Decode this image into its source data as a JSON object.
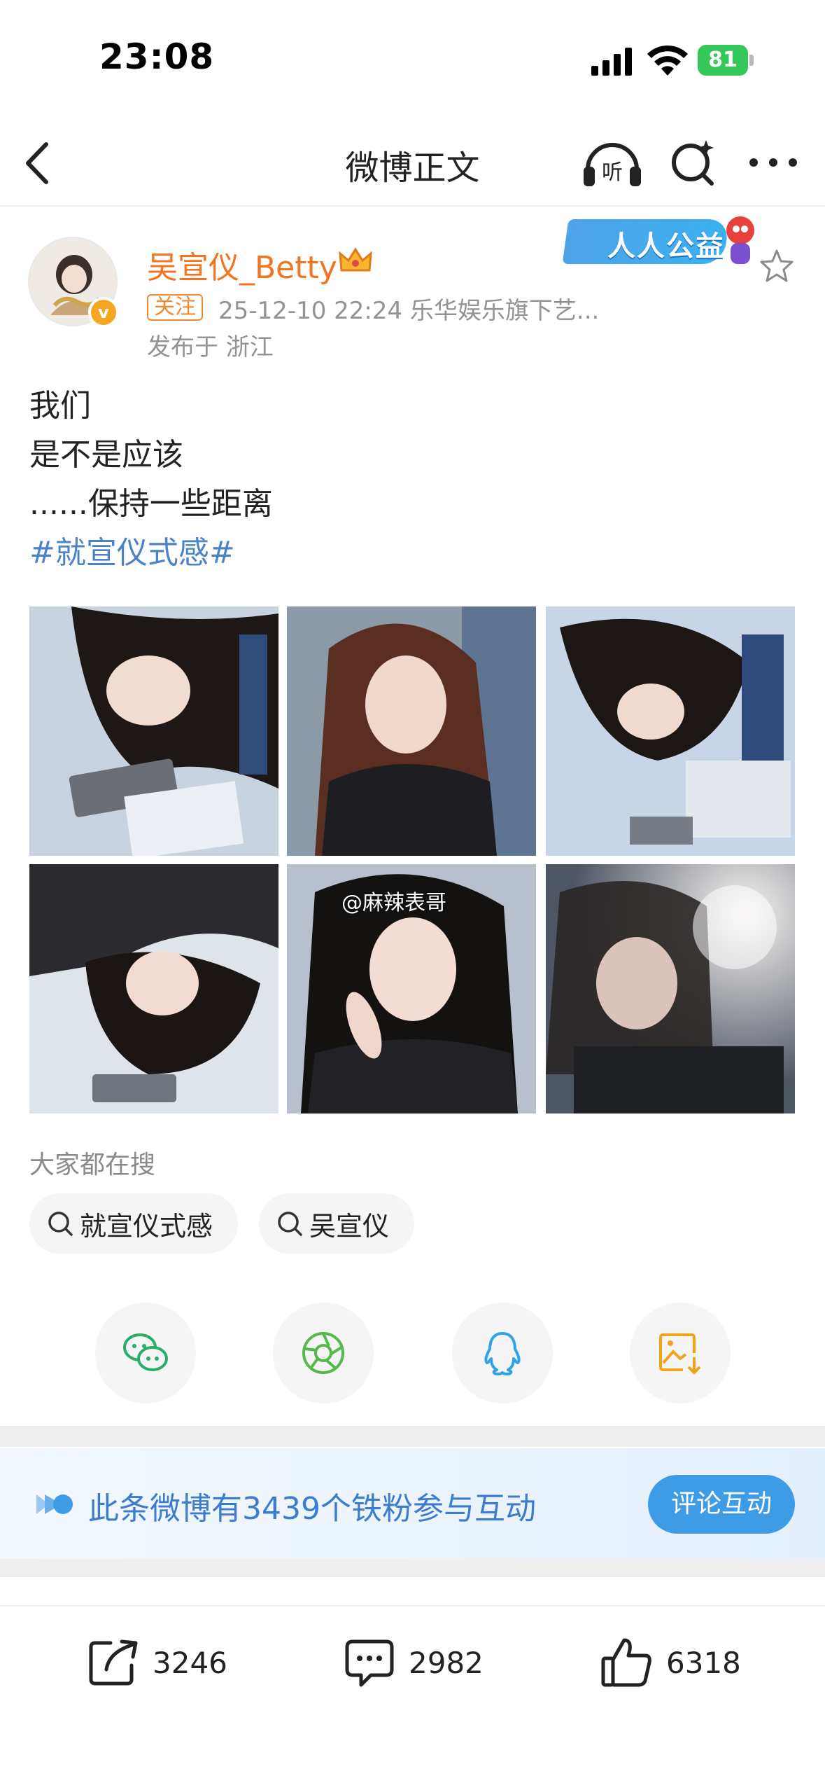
{
  "status_bar": {
    "time": "23:08",
    "battery": "81"
  },
  "nav": {
    "title": "微博正文"
  },
  "post": {
    "author": "吴宣仪_Betty",
    "follow_label": "关注",
    "meta": "25-12-10 22:24  乐华娱乐旗下艺...",
    "location": "发布于 浙江",
    "charity_badge": "人人公益",
    "text_lines": [
      "我们",
      "是不是应该",
      "......保持一些距离"
    ],
    "hashtag": "#就宣仪式感#",
    "watermark": "@麻辣表哥"
  },
  "search": {
    "title": "大家都在搜",
    "chips": [
      "就宣仪式感",
      "吴宣仪"
    ]
  },
  "fans": {
    "text": "此条微博有3439个铁粉参与互动",
    "button": "评论互动"
  },
  "actions": {
    "reposts": "3246",
    "comments": "2982",
    "likes": "6318"
  },
  "colors": {
    "username": "#f27420",
    "hashtag": "#4a83c9",
    "link_blue": "#3e9be6"
  }
}
